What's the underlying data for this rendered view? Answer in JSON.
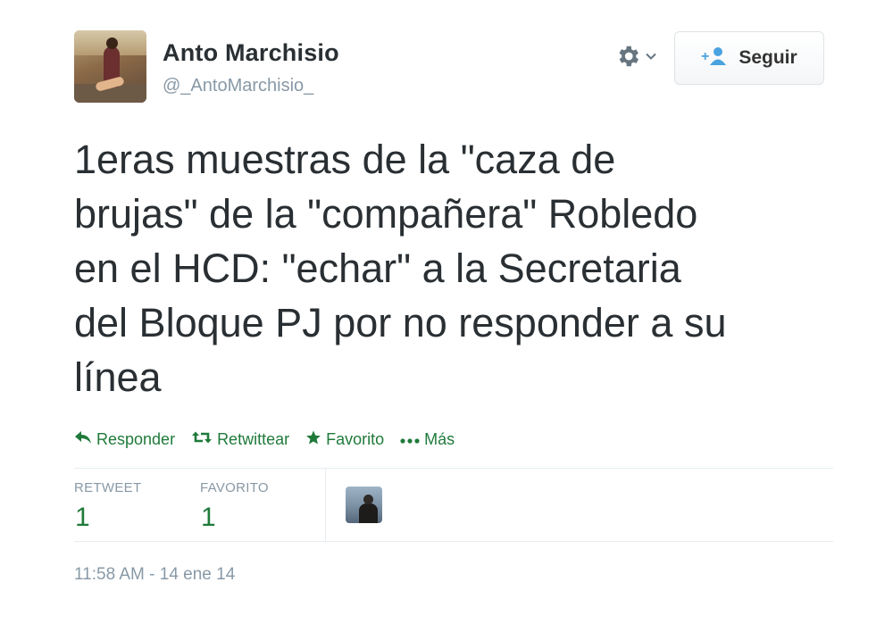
{
  "user": {
    "name": "Anto Marchisio",
    "handle": "@_AntoMarchisio_"
  },
  "header": {
    "follow_label": "Seguir"
  },
  "tweet": {
    "text": "1eras muestras de la \"caza de\nbrujas\" de la \"compañera\" Robledo\nen el HCD: \"echar\" a la Secretaria\ndel Bloque PJ por no responder a su\nlínea"
  },
  "actions": {
    "reply": "Responder",
    "retweet": "Retwittear",
    "favorite": "Favorito",
    "more": "Más"
  },
  "stats": {
    "retweets_label": "RETWEET",
    "retweets_value": "1",
    "favorites_label": "FAVORITO",
    "favorites_value": "1"
  },
  "timestamp": "11:58 AM - 14 ene 14",
  "colors": {
    "accent": "#1f7a3a",
    "muted": "#8899a6"
  },
  "icons": {
    "gear": "gear-icon",
    "follow": "add-user-icon",
    "reply": "reply-icon",
    "retweet": "retweet-icon",
    "favorite": "star-icon",
    "more": "more-dots-icon"
  }
}
